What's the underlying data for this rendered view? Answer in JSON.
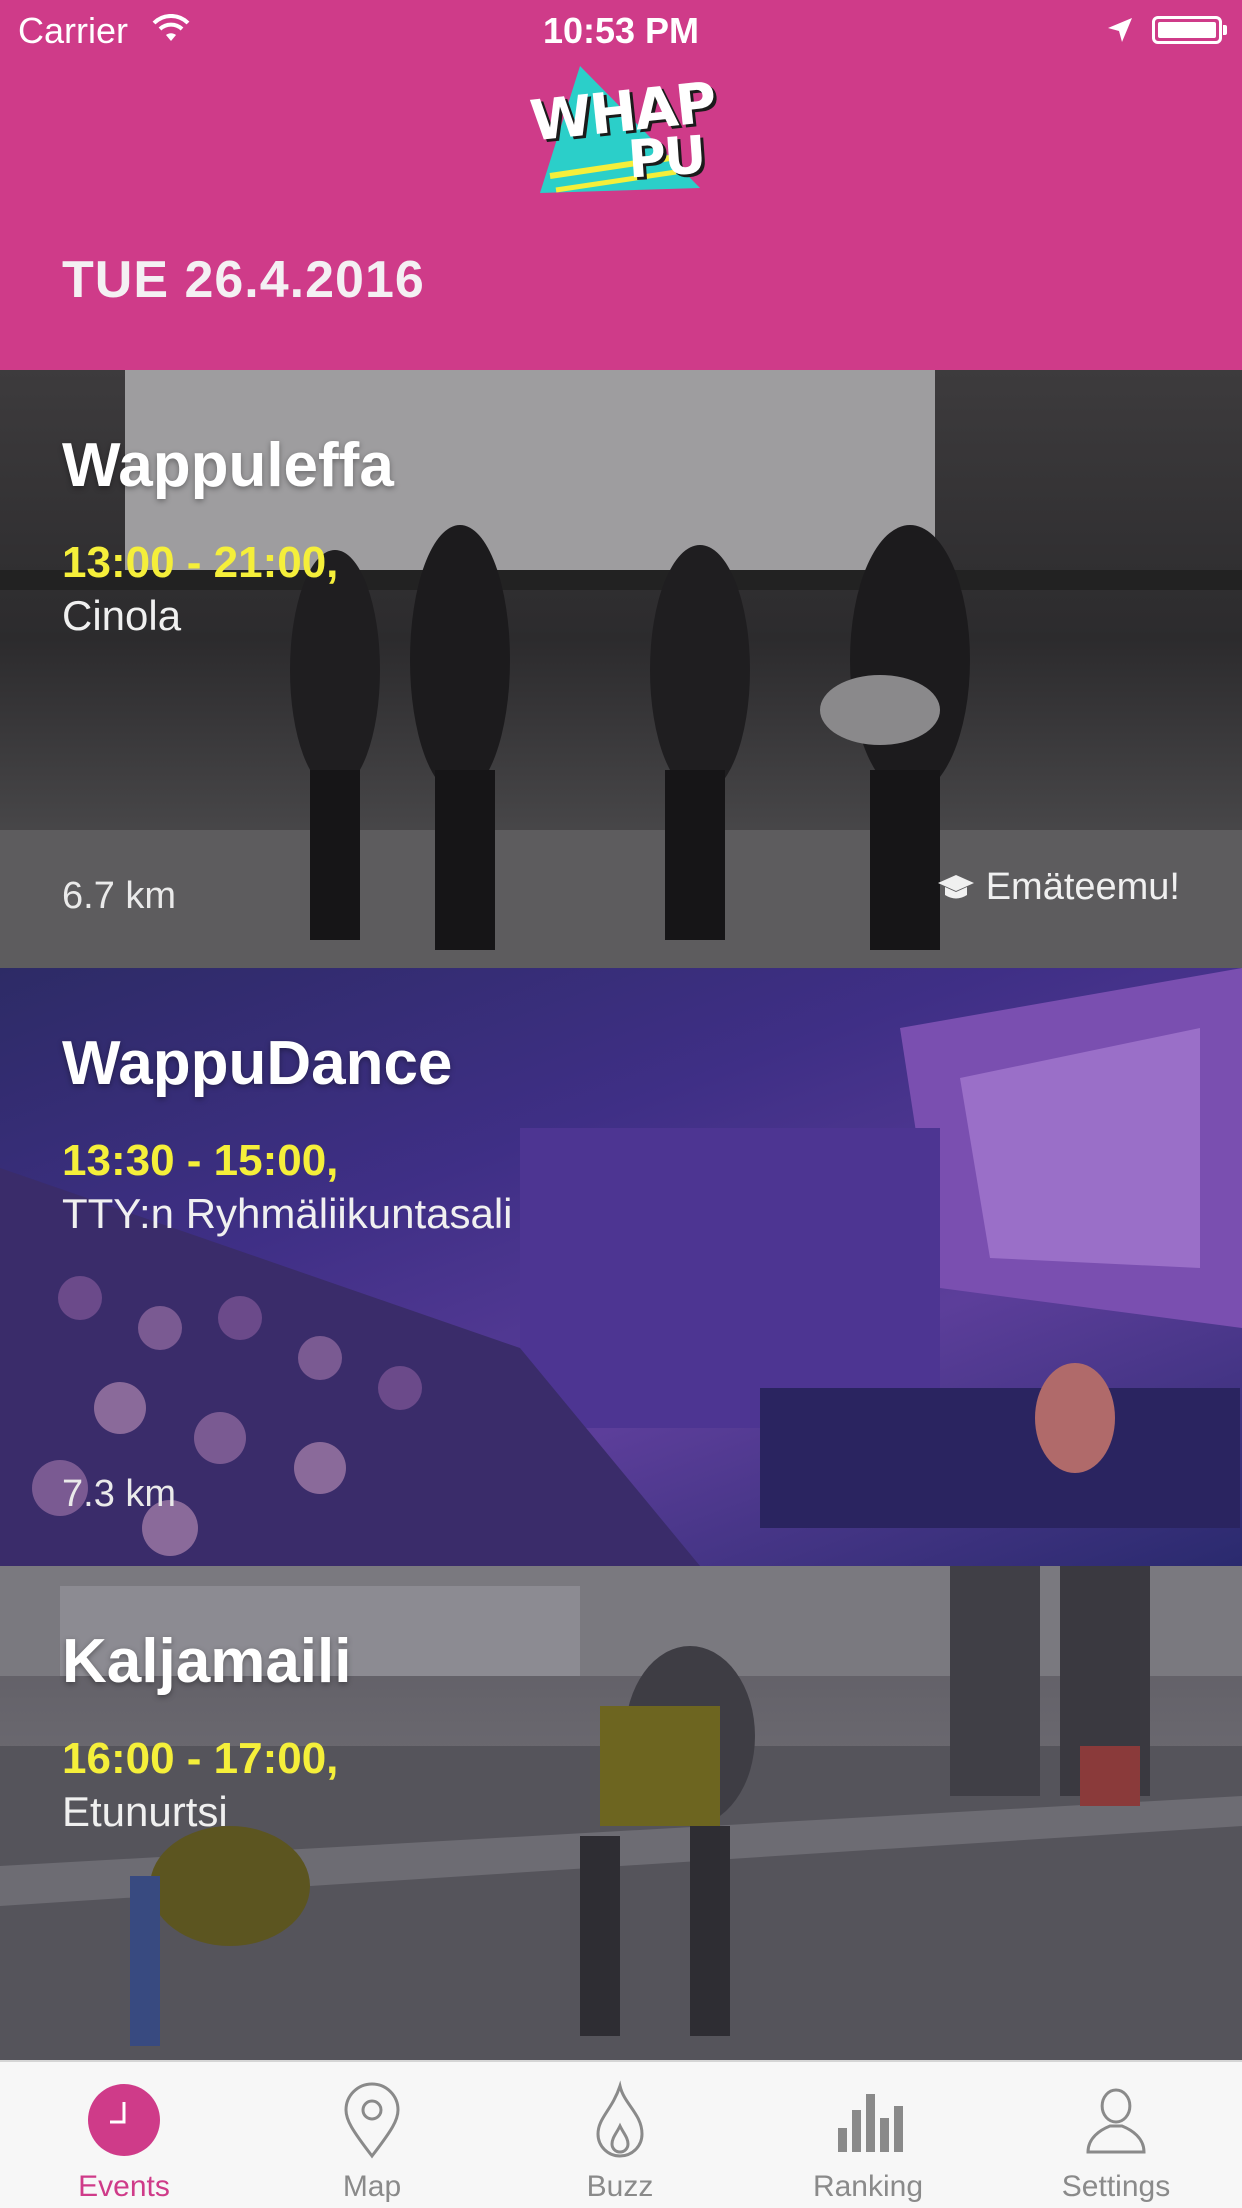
{
  "status_bar": {
    "carrier": "Carrier",
    "time": "10:53 PM"
  },
  "header": {
    "logo_line1": "WHAP",
    "logo_line2": "PU",
    "date": "TUE 26.4.2016",
    "background_color": "#cf3b89"
  },
  "events": [
    {
      "title": "Wappuleffa",
      "time": "13:00 - 21:00,",
      "place": "Cinola",
      "distance": "6.7 km",
      "badge": "Emäteemu!"
    },
    {
      "title": "WappuDance",
      "time": "13:30 - 15:00,",
      "place": "TTY:n Ryhmäliikuntasali",
      "distance": "7.3 km"
    },
    {
      "title": "Kaljamaili",
      "time": "16:00 - 17:00,",
      "place": "Etunurtsi"
    }
  ],
  "tabs": [
    {
      "label": "Events",
      "icon": "clock-icon",
      "active": true
    },
    {
      "label": "Map",
      "icon": "map-pin-icon",
      "active": false
    },
    {
      "label": "Buzz",
      "icon": "flame-icon",
      "active": false
    },
    {
      "label": "Ranking",
      "icon": "bar-chart-icon",
      "active": false
    },
    {
      "label": "Settings",
      "icon": "user-icon",
      "active": false
    }
  ],
  "colors": {
    "accent": "#cf3b89",
    "time_yellow": "#f5ef3a",
    "tab_inactive": "#8a8a8a"
  }
}
